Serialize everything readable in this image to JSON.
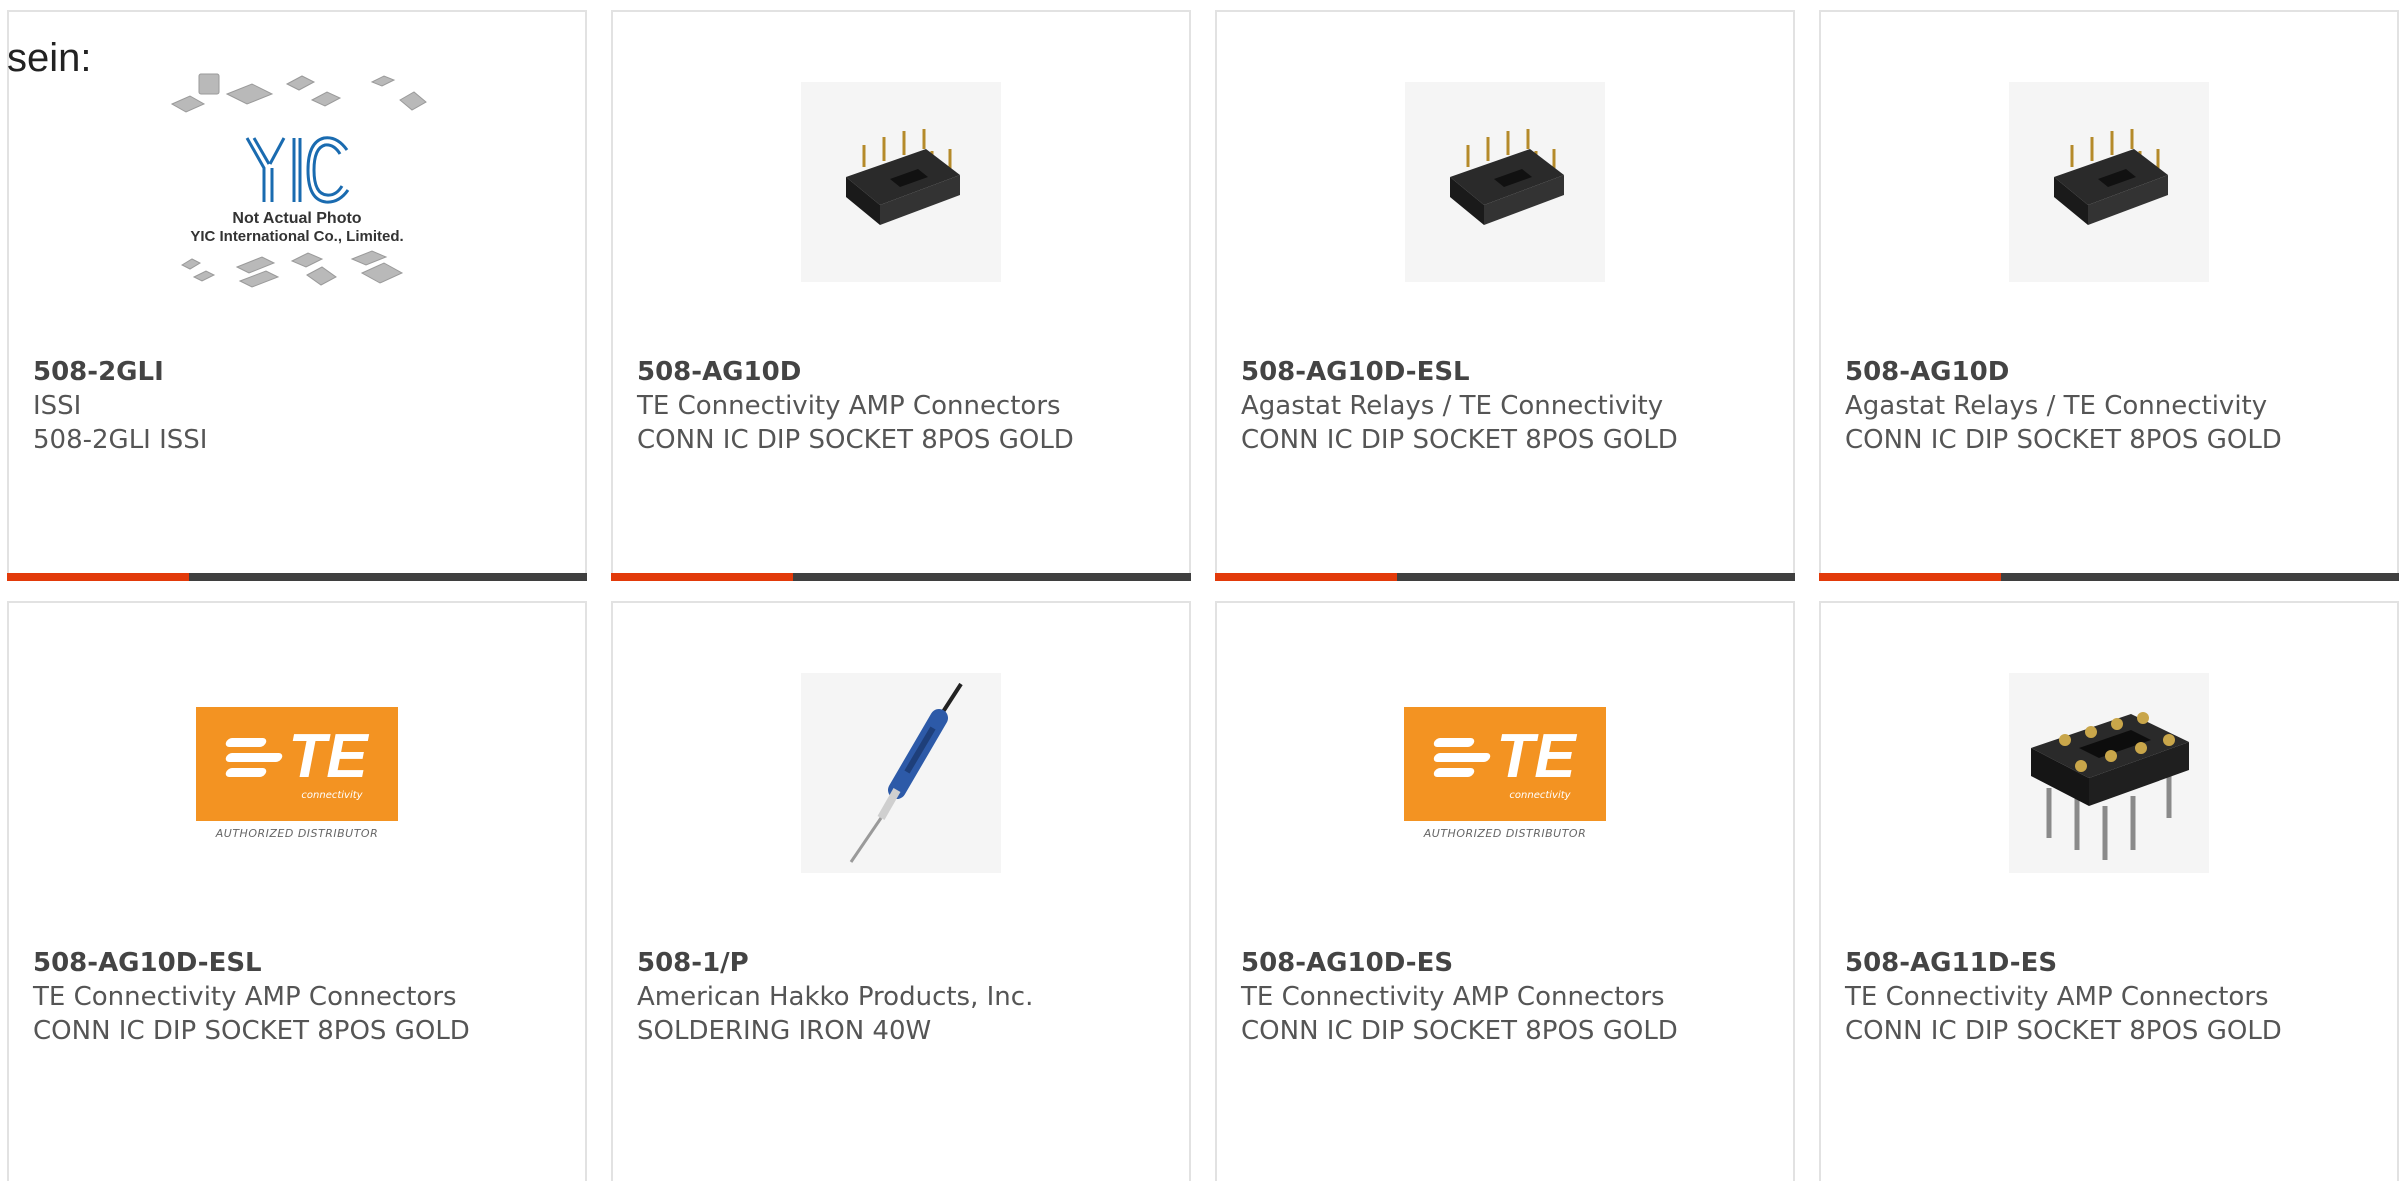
{
  "page": {
    "heading": "sein:"
  },
  "colors": {
    "accent": "#e23a0a",
    "bar": "#3f3f3f",
    "te_orange": "#f39322",
    "yic_blue": "#1a6bb0"
  },
  "products": [
    {
      "part_number": "508-2GLI",
      "manufacturer": "ISSI",
      "description": "508-2GLI ISSI",
      "image": "yic-placeholder",
      "image_text": [
        "Not Actual Photo",
        "YIC International Co., Limited."
      ]
    },
    {
      "part_number": "508-AG10D",
      "manufacturer": "TE Connectivity AMP Connectors",
      "description": "CONN IC DIP SOCKET 8POS GOLD",
      "image": "dip-socket-photo"
    },
    {
      "part_number": "508-AG10D-ESL",
      "manufacturer": "Agastat Relays / TE Connectivity",
      "description": "CONN IC DIP SOCKET 8POS GOLD",
      "image": "dip-socket-photo"
    },
    {
      "part_number": "508-AG10D",
      "manufacturer": "Agastat Relays / TE Connectivity",
      "description": "CONN IC DIP SOCKET 8POS GOLD",
      "image": "dip-socket-photo"
    },
    {
      "part_number": "508-AG10D-ESL",
      "manufacturer": "TE Connectivity AMP Connectors",
      "description": "CONN IC DIP SOCKET 8POS GOLD",
      "image": "te-logo",
      "image_text": [
        "TE",
        "connectivity",
        "AUTHORIZED DISTRIBUTOR"
      ]
    },
    {
      "part_number": "508-1/P",
      "manufacturer": "American Hakko Products, Inc.",
      "description": "SOLDERING IRON 40W",
      "image": "soldering-iron-photo"
    },
    {
      "part_number": "508-AG10D-ES",
      "manufacturer": "TE Connectivity AMP Connectors",
      "description": "CONN IC DIP SOCKET 8POS GOLD",
      "image": "te-logo",
      "image_text": [
        "TE",
        "connectivity",
        "AUTHORIZED DISTRIBUTOR"
      ]
    },
    {
      "part_number": "508-AG11D-ES",
      "manufacturer": "TE Connectivity AMP Connectors",
      "description": "CONN IC DIP SOCKET 8POS GOLD",
      "image": "dip-socket-open-photo"
    }
  ]
}
